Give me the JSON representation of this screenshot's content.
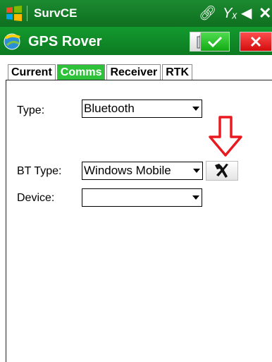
{
  "statusbar": {
    "app_name": "SurvCE",
    "icons": [
      "windows-logo-icon",
      "connectivity-icon",
      "signal-off-icon",
      "volume-muted-icon",
      "close-icon"
    ]
  },
  "titlebar": {
    "title": "GPS Rover",
    "buttons": [
      "settings-icon",
      "ok-check-icon",
      "cancel-x-icon"
    ]
  },
  "tabs": [
    {
      "label": "Current",
      "active": false
    },
    {
      "label": "Comms",
      "active": true
    },
    {
      "label": "Receiver",
      "active": false
    },
    {
      "label": "RTK",
      "active": false
    }
  ],
  "form": {
    "type_label": "Type:",
    "type_value": "Bluetooth",
    "bt_type_label": "BT Type:",
    "bt_type_value": "Windows Mobile",
    "device_label": "Device:",
    "device_value": ""
  },
  "colors": {
    "statusbar_bg": "#1b8a30",
    "titlebar_bg": "#139a2e",
    "active_tab": "#2ec23a",
    "annotation_arrow": "#e8191f"
  }
}
